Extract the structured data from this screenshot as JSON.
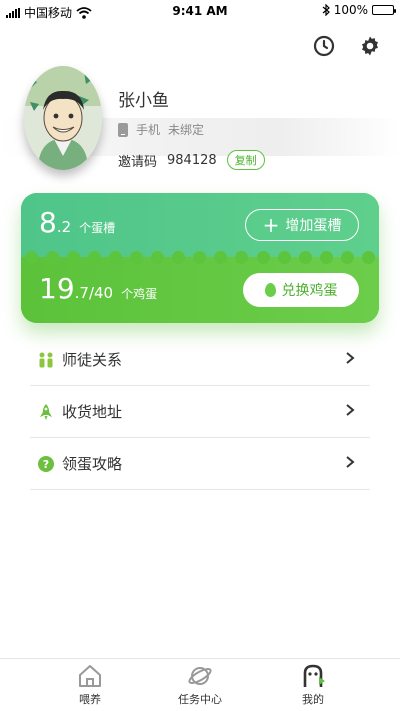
{
  "status_bar": {
    "carrier": "中国移动",
    "time": "9:41 AM",
    "battery": "100%"
  },
  "profile": {
    "name": "张小鱼",
    "phone_label": "手机",
    "phone_status": "未绑定",
    "invite_label": "邀请码",
    "invite_code": "984128",
    "copy_label": "复制"
  },
  "card": {
    "grooves_int": "8",
    "grooves_dec": ".2",
    "grooves_unit": "个蛋槽",
    "add_label": "增加蛋槽",
    "eggs_int": "19",
    "eggs_rest": ".7/40",
    "eggs_unit": "个鸡蛋",
    "exchange_label": "兑换鸡蛋",
    "accent": "#5ec141"
  },
  "menu": [
    {
      "label": "师徒关系",
      "icon": "people-icon"
    },
    {
      "label": "收货地址",
      "icon": "rocket-icon"
    },
    {
      "label": "领蛋攻略",
      "icon": "question-icon"
    }
  ],
  "tabs": [
    {
      "label": "喂养",
      "icon": "house-icon"
    },
    {
      "label": "任务中心",
      "icon": "planet-icon"
    },
    {
      "label": "我的",
      "icon": "profile-icon"
    }
  ]
}
